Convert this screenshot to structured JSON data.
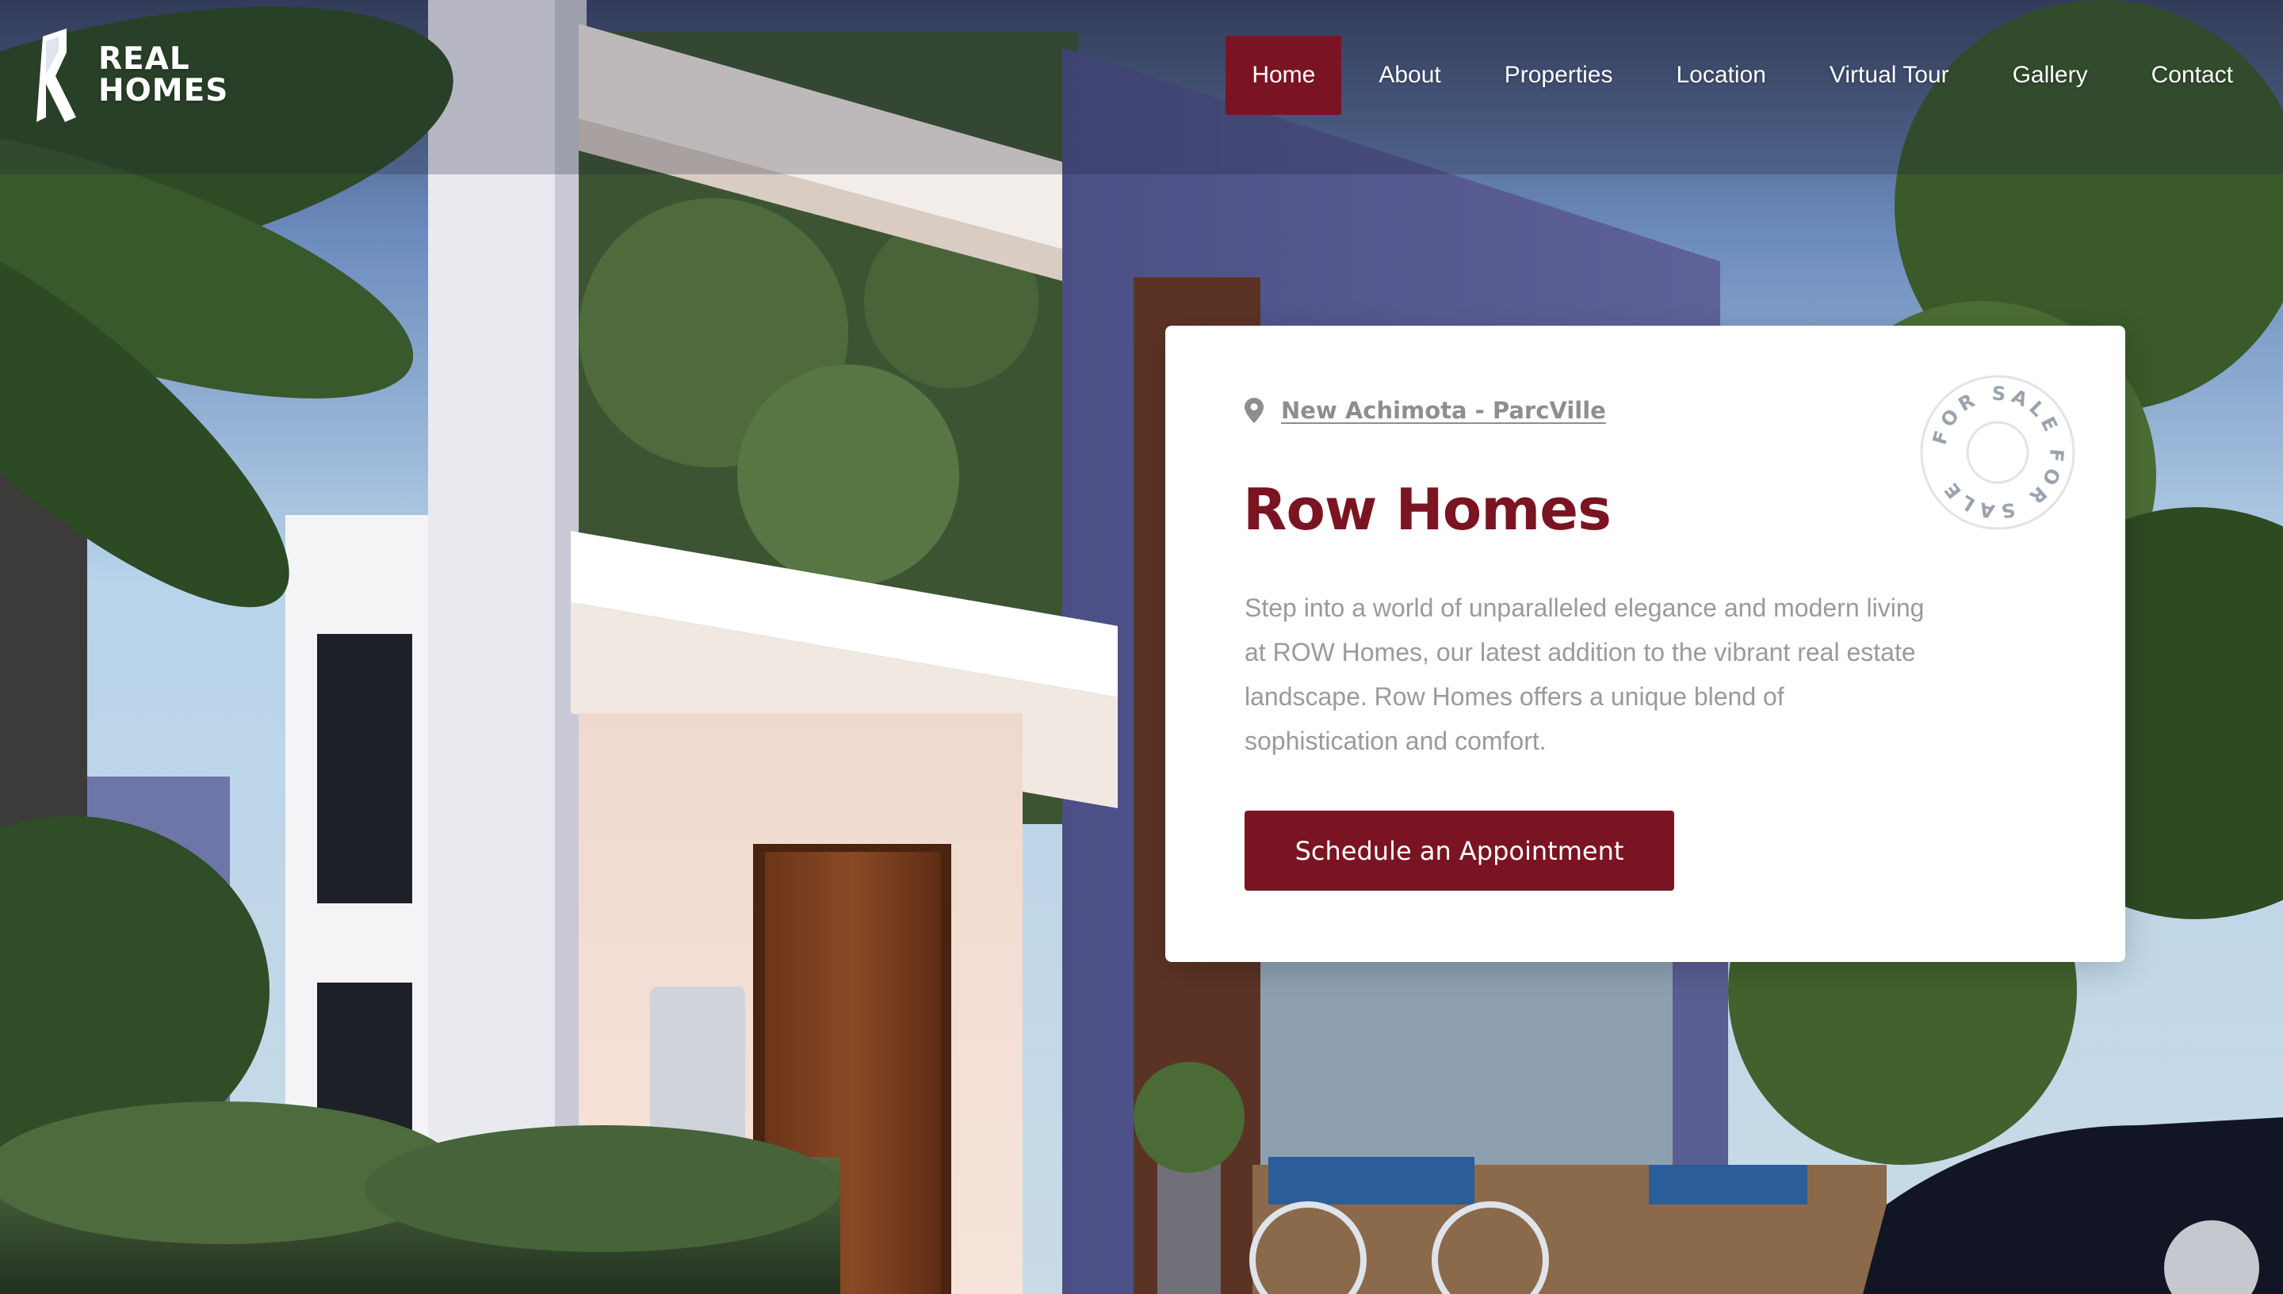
{
  "brand": {
    "line1": "REAL",
    "line2": "HOMES"
  },
  "nav": {
    "items": [
      {
        "label": "Home",
        "active": true
      },
      {
        "label": "About",
        "active": false
      },
      {
        "label": "Properties",
        "active": false
      },
      {
        "label": "Location",
        "active": false
      },
      {
        "label": "Virtual Tour",
        "active": false
      },
      {
        "label": "Gallery",
        "active": false
      },
      {
        "label": "Contact",
        "active": false
      }
    ]
  },
  "listing": {
    "location": "New Achimota - ParcVille",
    "title": "Row Homes",
    "description": "Step into a world of unparalleled elegance and modern living at ROW Homes, our latest addition to the vibrant real estate landscape. Row Homes offers a unique blend of sophistication and comfort.",
    "cta_label": "Schedule an Appointment",
    "badge_text": "FOR SALE FOR SALE"
  },
  "colors": {
    "accent": "#7b1422",
    "muted_text": "#9a9a9a",
    "card_bg": "#ffffff"
  },
  "icons": {
    "location": "map-pin-icon",
    "logo": "real-homes-logo"
  }
}
